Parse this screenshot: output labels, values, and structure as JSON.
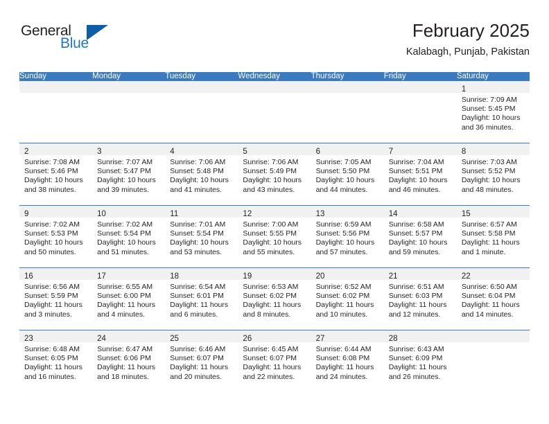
{
  "logo": {
    "word_one": "General",
    "word_two": "Blue",
    "triangle": "blue-triangle-icon",
    "colors": {
      "general": "#231f20",
      "blue": "#2077bd",
      "triangle": "#0b5ea8"
    }
  },
  "header": {
    "title": "February 2025",
    "subtitle": "Kalabagh, Punjab, Pakistan"
  },
  "theme": {
    "header_blue": "#3a7ac0",
    "daynum_band": "#f1f1f1",
    "text": "#231f20"
  },
  "calendar": {
    "weekday_headers": [
      "Sunday",
      "Monday",
      "Tuesday",
      "Wednesday",
      "Thursday",
      "Friday",
      "Saturday"
    ],
    "weeks": [
      [
        {
          "day": "",
          "lines": []
        },
        {
          "day": "",
          "lines": []
        },
        {
          "day": "",
          "lines": []
        },
        {
          "day": "",
          "lines": []
        },
        {
          "day": "",
          "lines": []
        },
        {
          "day": "",
          "lines": []
        },
        {
          "day": "1",
          "lines": [
            "Sunrise: 7:09 AM",
            "Sunset: 5:45 PM",
            "Daylight: 10 hours",
            "and 36 minutes."
          ]
        }
      ],
      [
        {
          "day": "2",
          "lines": [
            "Sunrise: 7:08 AM",
            "Sunset: 5:46 PM",
            "Daylight: 10 hours",
            "and 38 minutes."
          ]
        },
        {
          "day": "3",
          "lines": [
            "Sunrise: 7:07 AM",
            "Sunset: 5:47 PM",
            "Daylight: 10 hours",
            "and 39 minutes."
          ]
        },
        {
          "day": "4",
          "lines": [
            "Sunrise: 7:06 AM",
            "Sunset: 5:48 PM",
            "Daylight: 10 hours",
            "and 41 minutes."
          ]
        },
        {
          "day": "5",
          "lines": [
            "Sunrise: 7:06 AM",
            "Sunset: 5:49 PM",
            "Daylight: 10 hours",
            "and 43 minutes."
          ]
        },
        {
          "day": "6",
          "lines": [
            "Sunrise: 7:05 AM",
            "Sunset: 5:50 PM",
            "Daylight: 10 hours",
            "and 44 minutes."
          ]
        },
        {
          "day": "7",
          "lines": [
            "Sunrise: 7:04 AM",
            "Sunset: 5:51 PM",
            "Daylight: 10 hours",
            "and 46 minutes."
          ]
        },
        {
          "day": "8",
          "lines": [
            "Sunrise: 7:03 AM",
            "Sunset: 5:52 PM",
            "Daylight: 10 hours",
            "and 48 minutes."
          ]
        }
      ],
      [
        {
          "day": "9",
          "lines": [
            "Sunrise: 7:02 AM",
            "Sunset: 5:53 PM",
            "Daylight: 10 hours",
            "and 50 minutes."
          ]
        },
        {
          "day": "10",
          "lines": [
            "Sunrise: 7:02 AM",
            "Sunset: 5:54 PM",
            "Daylight: 10 hours",
            "and 51 minutes."
          ]
        },
        {
          "day": "11",
          "lines": [
            "Sunrise: 7:01 AM",
            "Sunset: 5:54 PM",
            "Daylight: 10 hours",
            "and 53 minutes."
          ]
        },
        {
          "day": "12",
          "lines": [
            "Sunrise: 7:00 AM",
            "Sunset: 5:55 PM",
            "Daylight: 10 hours",
            "and 55 minutes."
          ]
        },
        {
          "day": "13",
          "lines": [
            "Sunrise: 6:59 AM",
            "Sunset: 5:56 PM",
            "Daylight: 10 hours",
            "and 57 minutes."
          ]
        },
        {
          "day": "14",
          "lines": [
            "Sunrise: 6:58 AM",
            "Sunset: 5:57 PM",
            "Daylight: 10 hours",
            "and 59 minutes."
          ]
        },
        {
          "day": "15",
          "lines": [
            "Sunrise: 6:57 AM",
            "Sunset: 5:58 PM",
            "Daylight: 11 hours",
            "and 1 minute."
          ]
        }
      ],
      [
        {
          "day": "16",
          "lines": [
            "Sunrise: 6:56 AM",
            "Sunset: 5:59 PM",
            "Daylight: 11 hours",
            "and 3 minutes."
          ]
        },
        {
          "day": "17",
          "lines": [
            "Sunrise: 6:55 AM",
            "Sunset: 6:00 PM",
            "Daylight: 11 hours",
            "and 4 minutes."
          ]
        },
        {
          "day": "18",
          "lines": [
            "Sunrise: 6:54 AM",
            "Sunset: 6:01 PM",
            "Daylight: 11 hours",
            "and 6 minutes."
          ]
        },
        {
          "day": "19",
          "lines": [
            "Sunrise: 6:53 AM",
            "Sunset: 6:02 PM",
            "Daylight: 11 hours",
            "and 8 minutes."
          ]
        },
        {
          "day": "20",
          "lines": [
            "Sunrise: 6:52 AM",
            "Sunset: 6:02 PM",
            "Daylight: 11 hours",
            "and 10 minutes."
          ]
        },
        {
          "day": "21",
          "lines": [
            "Sunrise: 6:51 AM",
            "Sunset: 6:03 PM",
            "Daylight: 11 hours",
            "and 12 minutes."
          ]
        },
        {
          "day": "22",
          "lines": [
            "Sunrise: 6:50 AM",
            "Sunset: 6:04 PM",
            "Daylight: 11 hours",
            "and 14 minutes."
          ]
        }
      ],
      [
        {
          "day": "23",
          "lines": [
            "Sunrise: 6:48 AM",
            "Sunset: 6:05 PM",
            "Daylight: 11 hours",
            "and 16 minutes."
          ]
        },
        {
          "day": "24",
          "lines": [
            "Sunrise: 6:47 AM",
            "Sunset: 6:06 PM",
            "Daylight: 11 hours",
            "and 18 minutes."
          ]
        },
        {
          "day": "25",
          "lines": [
            "Sunrise: 6:46 AM",
            "Sunset: 6:07 PM",
            "Daylight: 11 hours",
            "and 20 minutes."
          ]
        },
        {
          "day": "26",
          "lines": [
            "Sunrise: 6:45 AM",
            "Sunset: 6:07 PM",
            "Daylight: 11 hours",
            "and 22 minutes."
          ]
        },
        {
          "day": "27",
          "lines": [
            "Sunrise: 6:44 AM",
            "Sunset: 6:08 PM",
            "Daylight: 11 hours",
            "and 24 minutes."
          ]
        },
        {
          "day": "28",
          "lines": [
            "Sunrise: 6:43 AM",
            "Sunset: 6:09 PM",
            "Daylight: 11 hours",
            "and 26 minutes."
          ]
        },
        {
          "day": "",
          "lines": []
        }
      ]
    ]
  }
}
